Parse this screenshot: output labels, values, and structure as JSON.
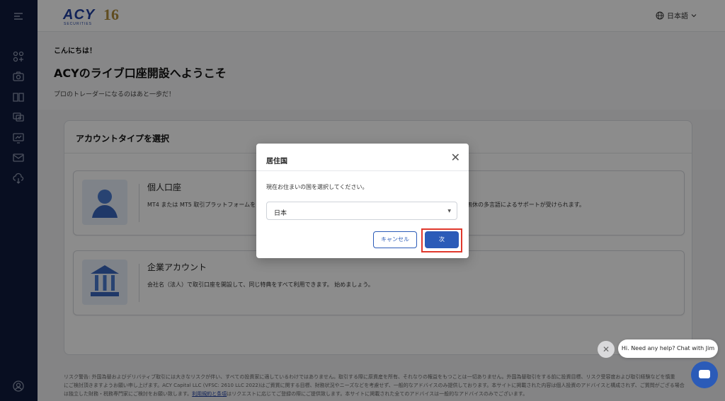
{
  "header": {
    "logo_text": "ACY",
    "logo_sub": "SECURITIES",
    "logo_anniv": "16",
    "language": "日本語"
  },
  "hero": {
    "greeting": "こんにちは！",
    "title": "ACYのライブ口座開設へようこそ",
    "subtitle": "プロのトレーダーになるのはあと一歩だ！"
  },
  "panel": {
    "title": "アカウントタイプを選択",
    "cards": [
      {
        "title": "個人口座",
        "desc": "MT4 または MT5 取引プラットフォームを",
        "desc_tail": "無休の多言語によるサポートが受けられます。"
      },
      {
        "title": "企業アカウント",
        "desc": "会社名（法人）で取引口座を開設して、同じ特典をすべて利用できます。 始めましょう。"
      }
    ]
  },
  "disclaimer": {
    "line1": "リスク警告: 外国為替およびデリバティブ取引には大きなリスクが伴い、すべての投資家に適しているわけではありません。取引する際に原資産を所有、それなりの権益をもつことは一切ありません。外国為替取引をする前に投資目標、リスク受容度および取引経験などを慎重",
    "line2": "にご検討頂きますようお願い申し上げます。ACY Capital LLC (VFSC: 2610 LLC 2022)はご資質に関する目標、財務状況やニーズなどを考慮せず、一般的なアドバイスのみ提供しております。本サイトに掲載された内容は個人投資のアドバイスと構成されず、ご質問がござる場合",
    "line3_pre": "は独立した財務・税務専門家にご検討をお願い致します。",
    "line3_link": "利用規約と条項",
    "line3_post": "はリクエストに応じてご登録の際にご提供致します。本サイトに掲載された全てのアドバイスは一般的なアドバイスのみでございます。"
  },
  "modal": {
    "title": "居住国",
    "prompt": "現在お住まいの国を選択してください。",
    "selected_country": "日本",
    "cancel_label": "キャンセル",
    "next_label": "次"
  },
  "chat": {
    "message": "Hi. Need any help? Chat with Jim"
  },
  "colors": {
    "sidebar": "#0f1b3d",
    "primary": "#2b5bb8",
    "highlight": "#e0382c"
  }
}
